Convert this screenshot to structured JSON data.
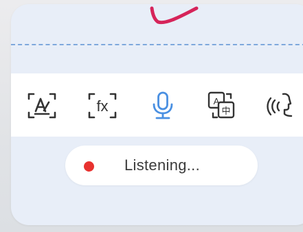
{
  "colors": {
    "panel_bg": "#e8eef8",
    "accent_blue": "#4a90e2",
    "icon_dark": "#333333",
    "stroke_pink": "#d6245a",
    "dashed_line": "#7ea8dc",
    "recording_red": "#e8322f"
  },
  "toolbar": {
    "tools": [
      {
        "icon": "text-recognition-icon",
        "active": false
      },
      {
        "icon": "formula-icon",
        "label": "fx",
        "active": false
      },
      {
        "icon": "microphone-icon",
        "active": true
      },
      {
        "icon": "translate-icon",
        "label_a": "A",
        "label_b": "中",
        "active": false
      },
      {
        "icon": "voice-speech-icon",
        "active": false
      }
    ]
  },
  "status": {
    "text": "Listening..."
  }
}
